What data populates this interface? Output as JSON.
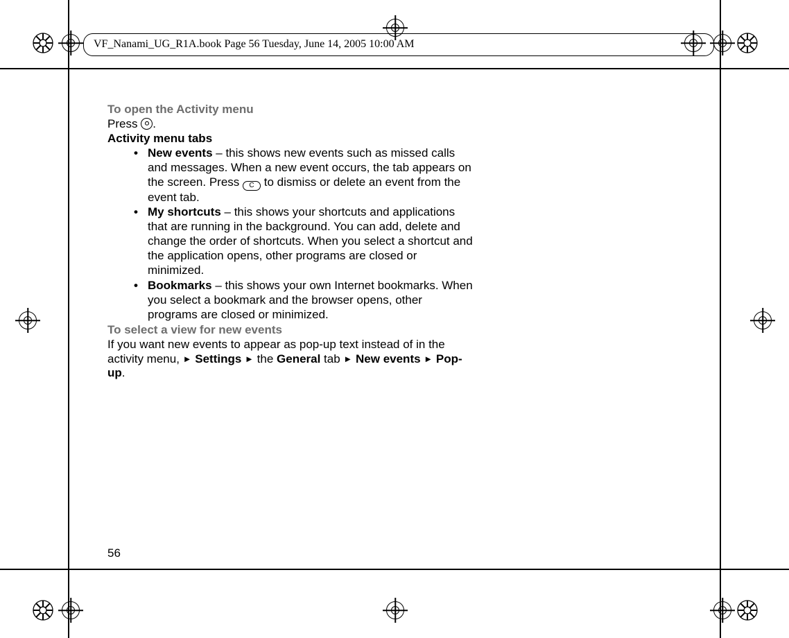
{
  "header": {
    "text": "VF_Nanami_UG_R1A.book  Page 56  Tuesday, June 14, 2005  10:00 AM"
  },
  "page_number": "56",
  "section1": {
    "heading": "To open the Activity menu",
    "line_before_icon": "Press ",
    "line_after_icon": "."
  },
  "section2": {
    "heading": "Activity menu tabs",
    "items": [
      {
        "term": "New events",
        "before_key": " – this shows new events such as missed calls and messages. When a new event occurs, the tab appears on the screen. Press ",
        "key_label": "C",
        "after_key": " to dismiss or delete an event from the event tab."
      },
      {
        "term": "My shortcuts",
        "text": " – this shows your shortcuts and applications that are running in the background. You can add, delete and change the order of shortcuts. When you select a shortcut and the application opens, other programs are closed or minimized."
      },
      {
        "term": "Bookmarks",
        "text": " – this shows your own Internet bookmarks. When you select a bookmark and the browser opens, other programs are closed or minimized."
      }
    ]
  },
  "section3": {
    "heading": "To select a view for new events",
    "pre": "If you want new events to appear as pop-up text instead of in the activity menu, ",
    "nav_parts": {
      "arrow": "►",
      "p1": " Set­tings ",
      "p2": " the ",
      "p3": "General",
      "p4": " tab ",
      "p5": " New events ",
      "p6": " Pop-up",
      "end": "."
    }
  }
}
